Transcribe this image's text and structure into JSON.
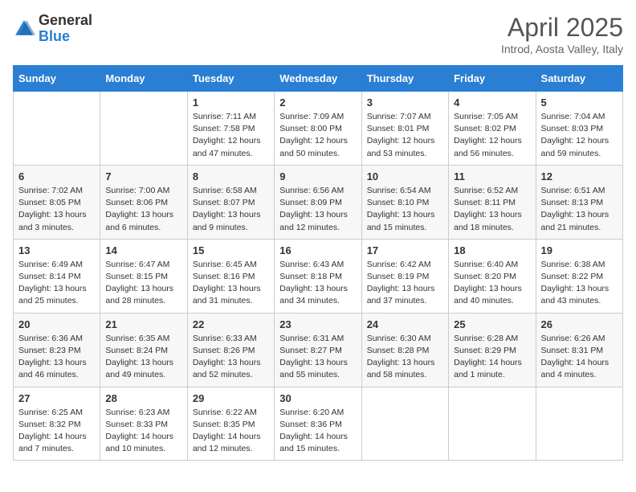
{
  "logo": {
    "general": "General",
    "blue": "Blue"
  },
  "title": "April 2025",
  "subtitle": "Introd, Aosta Valley, Italy",
  "days_of_week": [
    "Sunday",
    "Monday",
    "Tuesday",
    "Wednesday",
    "Thursday",
    "Friday",
    "Saturday"
  ],
  "weeks": [
    [
      null,
      null,
      {
        "day": 1,
        "sunrise": "7:11 AM",
        "sunset": "7:58 PM",
        "daylight": "12 hours and 47 minutes."
      },
      {
        "day": 2,
        "sunrise": "7:09 AM",
        "sunset": "8:00 PM",
        "daylight": "12 hours and 50 minutes."
      },
      {
        "day": 3,
        "sunrise": "7:07 AM",
        "sunset": "8:01 PM",
        "daylight": "12 hours and 53 minutes."
      },
      {
        "day": 4,
        "sunrise": "7:05 AM",
        "sunset": "8:02 PM",
        "daylight": "12 hours and 56 minutes."
      },
      {
        "day": 5,
        "sunrise": "7:04 AM",
        "sunset": "8:03 PM",
        "daylight": "12 hours and 59 minutes."
      }
    ],
    [
      {
        "day": 6,
        "sunrise": "7:02 AM",
        "sunset": "8:05 PM",
        "daylight": "13 hours and 3 minutes."
      },
      {
        "day": 7,
        "sunrise": "7:00 AM",
        "sunset": "8:06 PM",
        "daylight": "13 hours and 6 minutes."
      },
      {
        "day": 8,
        "sunrise": "6:58 AM",
        "sunset": "8:07 PM",
        "daylight": "13 hours and 9 minutes."
      },
      {
        "day": 9,
        "sunrise": "6:56 AM",
        "sunset": "8:09 PM",
        "daylight": "13 hours and 12 minutes."
      },
      {
        "day": 10,
        "sunrise": "6:54 AM",
        "sunset": "8:10 PM",
        "daylight": "13 hours and 15 minutes."
      },
      {
        "day": 11,
        "sunrise": "6:52 AM",
        "sunset": "8:11 PM",
        "daylight": "13 hours and 18 minutes."
      },
      {
        "day": 12,
        "sunrise": "6:51 AM",
        "sunset": "8:13 PM",
        "daylight": "13 hours and 21 minutes."
      }
    ],
    [
      {
        "day": 13,
        "sunrise": "6:49 AM",
        "sunset": "8:14 PM",
        "daylight": "13 hours and 25 minutes."
      },
      {
        "day": 14,
        "sunrise": "6:47 AM",
        "sunset": "8:15 PM",
        "daylight": "13 hours and 28 minutes."
      },
      {
        "day": 15,
        "sunrise": "6:45 AM",
        "sunset": "8:16 PM",
        "daylight": "13 hours and 31 minutes."
      },
      {
        "day": 16,
        "sunrise": "6:43 AM",
        "sunset": "8:18 PM",
        "daylight": "13 hours and 34 minutes."
      },
      {
        "day": 17,
        "sunrise": "6:42 AM",
        "sunset": "8:19 PM",
        "daylight": "13 hours and 37 minutes."
      },
      {
        "day": 18,
        "sunrise": "6:40 AM",
        "sunset": "8:20 PM",
        "daylight": "13 hours and 40 minutes."
      },
      {
        "day": 19,
        "sunrise": "6:38 AM",
        "sunset": "8:22 PM",
        "daylight": "13 hours and 43 minutes."
      }
    ],
    [
      {
        "day": 20,
        "sunrise": "6:36 AM",
        "sunset": "8:23 PM",
        "daylight": "13 hours and 46 minutes."
      },
      {
        "day": 21,
        "sunrise": "6:35 AM",
        "sunset": "8:24 PM",
        "daylight": "13 hours and 49 minutes."
      },
      {
        "day": 22,
        "sunrise": "6:33 AM",
        "sunset": "8:26 PM",
        "daylight": "13 hours and 52 minutes."
      },
      {
        "day": 23,
        "sunrise": "6:31 AM",
        "sunset": "8:27 PM",
        "daylight": "13 hours and 55 minutes."
      },
      {
        "day": 24,
        "sunrise": "6:30 AM",
        "sunset": "8:28 PM",
        "daylight": "13 hours and 58 minutes."
      },
      {
        "day": 25,
        "sunrise": "6:28 AM",
        "sunset": "8:29 PM",
        "daylight": "14 hours and 1 minute."
      },
      {
        "day": 26,
        "sunrise": "6:26 AM",
        "sunset": "8:31 PM",
        "daylight": "14 hours and 4 minutes."
      }
    ],
    [
      {
        "day": 27,
        "sunrise": "6:25 AM",
        "sunset": "8:32 PM",
        "daylight": "14 hours and 7 minutes."
      },
      {
        "day": 28,
        "sunrise": "6:23 AM",
        "sunset": "8:33 PM",
        "daylight": "14 hours and 10 minutes."
      },
      {
        "day": 29,
        "sunrise": "6:22 AM",
        "sunset": "8:35 PM",
        "daylight": "14 hours and 12 minutes."
      },
      {
        "day": 30,
        "sunrise": "6:20 AM",
        "sunset": "8:36 PM",
        "daylight": "14 hours and 15 minutes."
      },
      null,
      null,
      null
    ]
  ]
}
